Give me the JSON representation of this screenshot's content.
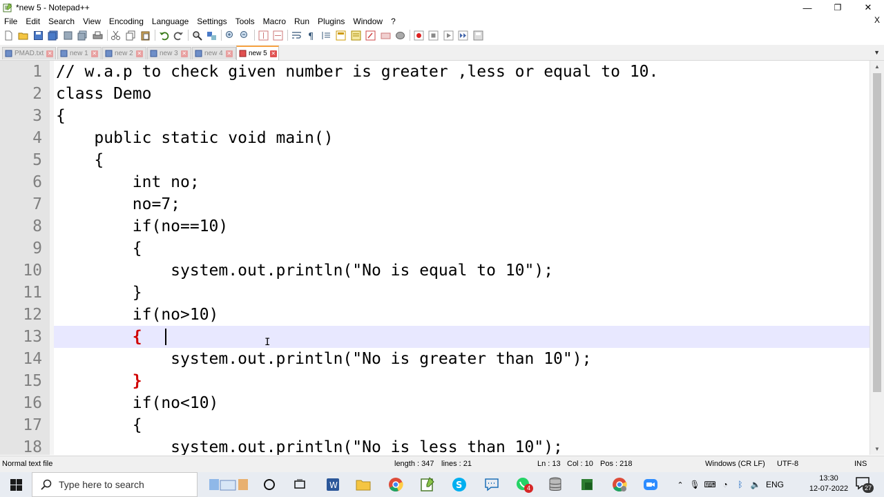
{
  "window": {
    "title": "*new 5 - Notepad++",
    "minimize": "—",
    "maximize": "❐",
    "close": "✕"
  },
  "menu": {
    "items": [
      "File",
      "Edit",
      "Search",
      "View",
      "Encoding",
      "Language",
      "Settings",
      "Tools",
      "Macro",
      "Run",
      "Plugins",
      "Window",
      "?"
    ],
    "close_doc": "X"
  },
  "tabs": [
    {
      "label": "PMAD.txt",
      "active": false
    },
    {
      "label": "new 1",
      "active": false
    },
    {
      "label": "new 2",
      "active": false
    },
    {
      "label": "new 3",
      "active": false
    },
    {
      "label": "new 4",
      "active": false
    },
    {
      "label": "new 5",
      "active": true
    }
  ],
  "tab_dropdown": "▼",
  "editor": {
    "current_line": 13,
    "lines": [
      {
        "num": "1",
        "text": "// w.a.p to check given number is greater ,less or equal to 10."
      },
      {
        "num": "2",
        "text": "class Demo"
      },
      {
        "num": "3",
        "text": "{"
      },
      {
        "num": "4",
        "text": "    public static void main()"
      },
      {
        "num": "5",
        "text": "    {"
      },
      {
        "num": "6",
        "text": "        int no;"
      },
      {
        "num": "7",
        "text": "        no=7;"
      },
      {
        "num": "8",
        "text": "        if(no==10)"
      },
      {
        "num": "9",
        "text": "        {"
      },
      {
        "num": "10",
        "text": "            system.out.println(\"No is equal to 10\");"
      },
      {
        "num": "11",
        "text": "        }"
      },
      {
        "num": "12",
        "text": "        if(no>10)"
      },
      {
        "num": "13",
        "text": "        {"
      },
      {
        "num": "14",
        "text": "            system.out.println(\"No is greater than 10\");"
      },
      {
        "num": "15",
        "text": "        }"
      },
      {
        "num": "16",
        "text": "        if(no<10)"
      },
      {
        "num": "17",
        "text": "        {"
      },
      {
        "num": "18",
        "text": "            system.out.println(\"No is less than 10\");"
      }
    ]
  },
  "status": {
    "filetype": "Normal text file",
    "length": "length : 347",
    "lines": "lines : 21",
    "ln": "Ln : 13",
    "col": "Col : 10",
    "pos": "Pos : 218",
    "eol": "Windows (CR LF)",
    "encoding": "UTF-8",
    "mode": "INS"
  },
  "taskbar": {
    "search_placeholder": "Type here to search",
    "language": "ENG",
    "time": "13:30",
    "date": "12-07-2022",
    "notification_count": "27",
    "whatsapp_badge": "4"
  },
  "colors": {
    "gutter_bg": "#e4e4e4",
    "current_line_bg": "#e8e8ff",
    "brace_highlight": "#d00000",
    "active_tab_accent": "#f7a241"
  }
}
